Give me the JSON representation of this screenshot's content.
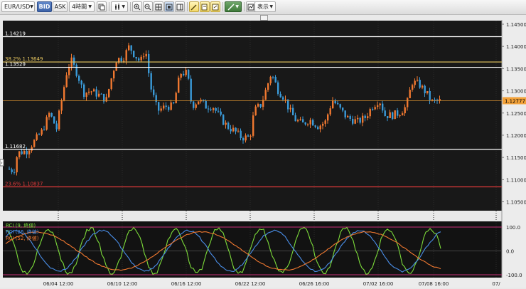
{
  "toolbar": {
    "symbol": "EUR/USD",
    "bid_label": "BID",
    "ask_label": "ASK",
    "timeframe": "4時間",
    "display_label": "表示"
  },
  "chart": {
    "price_axis_labels": [
      "1.14500",
      "1.14000",
      "1.13500",
      "1.13000",
      "1.12500",
      "1.12000",
      "1.11500",
      "1.11000",
      "1.10500"
    ],
    "current_price": "1.12777",
    "level_lines": [
      {
        "label": "1.14219",
        "price": 1.14219,
        "color": "#ffffff"
      },
      {
        "label": "38.2%  1.13649",
        "price": 1.13649,
        "color": "#e8c860"
      },
      {
        "label": "1.13529",
        "price": 1.13529,
        "color": "#ffffff"
      },
      {
        "label": "1.11682",
        "price": 1.11682,
        "color": "#ffffff"
      },
      {
        "label": "23.6%  1.10837",
        "price": 1.10837,
        "color": "#e03a3a"
      }
    ],
    "rci_legend": [
      {
        "label": "RCI (9, 終値)",
        "color": "#7ddc3a"
      },
      {
        "label": "RCI (26, 終値)",
        "color": "#4a8ee8"
      },
      {
        "label": "RCI (52, 終値)",
        "color": "#f07830"
      }
    ],
    "rci_axis_labels": [
      "100.0",
      "0.0",
      "-100.0"
    ],
    "x_axis_labels": [
      "06/04 12:00",
      "06/10 12:00",
      "06/16 12:00",
      "06/22 12:00",
      "06/26 16:00",
      "07/02 16:00",
      "07/08 16:00",
      "07/"
    ]
  },
  "colors": {
    "bull": "#f07830",
    "bear": "#3a9ad8",
    "price_bg": "#181818",
    "rci_bg": "#121212",
    "accent": "#3d63a8"
  }
}
